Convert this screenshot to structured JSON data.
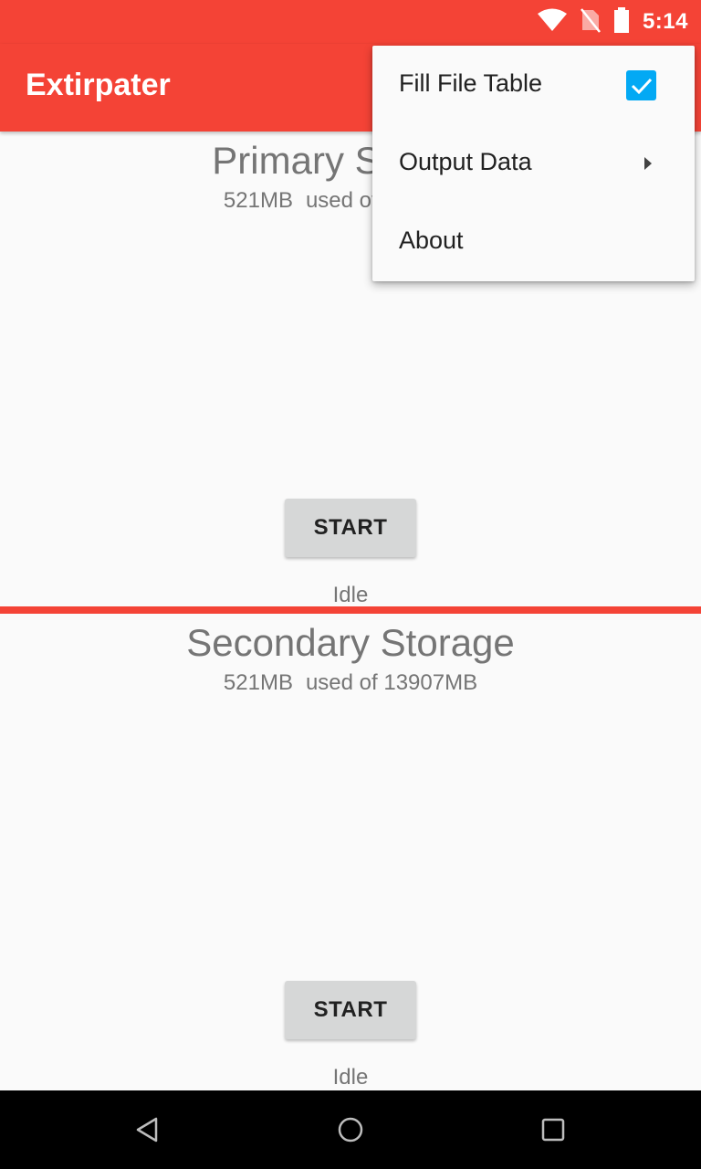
{
  "status_bar": {
    "time": "5:14",
    "icons": [
      "wifi-icon",
      "no-sim-icon",
      "battery-icon"
    ]
  },
  "app_bar": {
    "title": "Extirpater"
  },
  "sections": [
    {
      "title": "Primary Storage",
      "used": "521MB",
      "total_text": "used of 13907MB",
      "button_label": "START",
      "status": "Idle"
    },
    {
      "title": "Secondary Storage",
      "used": "521MB",
      "total_text": "used of 13907MB",
      "button_label": "START",
      "status": "Idle"
    }
  ],
  "overflow_menu": {
    "items": [
      {
        "label": "Fill File Table",
        "checked": true
      },
      {
        "label": "Output Data",
        "has_submenu": true
      },
      {
        "label": "About"
      }
    ]
  },
  "nav_bar": {
    "buttons": [
      "back-icon",
      "home-icon",
      "recents-icon"
    ]
  },
  "colors": {
    "primary": "#f44336",
    "accent": "#03a9f4",
    "background": "#fafafa",
    "button": "#d6d7d7"
  }
}
